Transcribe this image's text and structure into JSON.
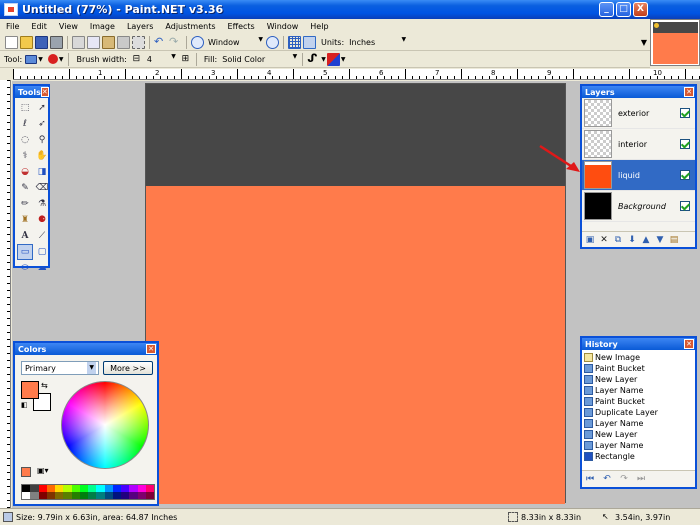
{
  "window": {
    "title": "Untitled (77%) - Paint.NET v3.36",
    "min": "_",
    "max": "□",
    "close": "X"
  },
  "menu": [
    "File",
    "Edit",
    "View",
    "Image",
    "Layers",
    "Adjustments",
    "Effects",
    "Window",
    "Help"
  ],
  "toolbar": {
    "zoom_value": "Window",
    "units_label": "Units:",
    "units_value": "Inches",
    "tool_label": "Tool:",
    "brush_label": "Brush width:",
    "brush_value": "4",
    "fill_label": "Fill:",
    "fill_value": "Solid Color"
  },
  "ruler": {
    "h_labels": [
      "1",
      "2",
      "3",
      "4",
      "5",
      "6",
      "7",
      "8",
      "9",
      "10"
    ],
    "v_labels": [
      "1",
      "2",
      "3",
      "4",
      "5",
      "6"
    ]
  },
  "tools_panel": {
    "title": "Tools"
  },
  "layers_panel": {
    "title": "Layers",
    "items": [
      {
        "name": "exterior"
      },
      {
        "name": "interior"
      },
      {
        "name": "liquid"
      },
      {
        "name": "Background"
      }
    ]
  },
  "history_panel": {
    "title": "History",
    "items": [
      "New Image",
      "Paint Bucket",
      "New Layer",
      "Layer Name",
      "Paint Bucket",
      "Duplicate Layer",
      "Layer Name",
      "New Layer",
      "Layer Name",
      "Rectangle"
    ]
  },
  "colors_panel": {
    "title": "Colors",
    "mode": "Primary",
    "more_button": "More >>",
    "primary_color": "#ff7b4b",
    "secondary_color": "#ffffff",
    "palette": [
      "#000000",
      "#404040",
      "#ff0000",
      "#ff6a00",
      "#ffd800",
      "#b6ff00",
      "#4cff00",
      "#00ff21",
      "#00ff90",
      "#00ffff",
      "#0094ff",
      "#0026ff",
      "#4800ff",
      "#b200ff",
      "#ff00dc",
      "#ff006e",
      "#ffffff",
      "#808080",
      "#7f0000",
      "#7f3300",
      "#7f6a00",
      "#5b7f00",
      "#267f00",
      "#007f0e",
      "#007f46",
      "#007f7f",
      "#004a7f",
      "#00137f",
      "#21007f",
      "#57007f",
      "#7f006e",
      "#7f0037"
    ]
  },
  "canvas": {
    "top_color": "#474747",
    "bottom_color": "#ff7b4b"
  },
  "status": {
    "size": "Size: 9.79in x 6.63in, area: 64.87 Inches",
    "selection": "8.33in x 8.33in",
    "cursor": "3.54in, 3.97in"
  }
}
